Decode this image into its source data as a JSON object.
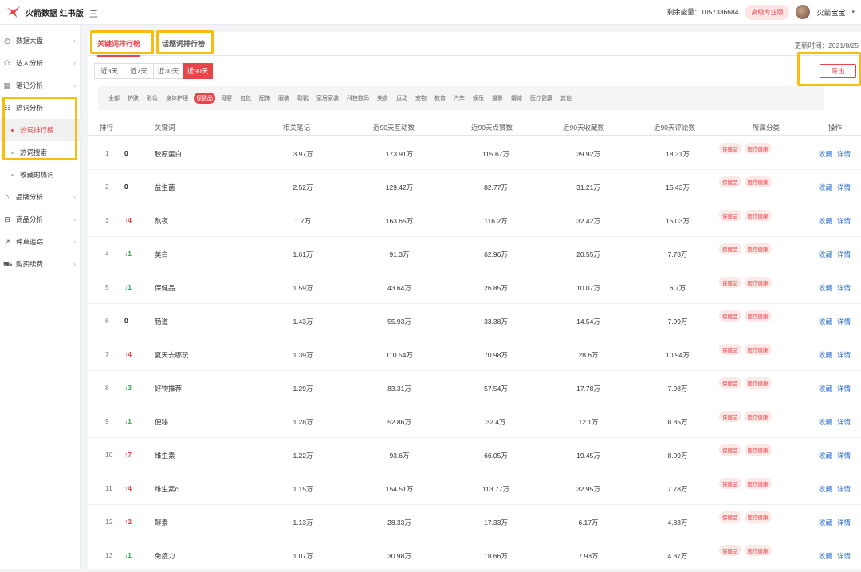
{
  "header": {
    "logo_text": "火箭数据 红书版",
    "menu_toggle": "三",
    "energy_label": "剩余能量：1057336684",
    "pro_badge": "高级专业版",
    "username": "火箭宝宝",
    "caret": "▾"
  },
  "sidebar": {
    "items": [
      {
        "icon": "dashboard-icon",
        "glyph": "◷",
        "label": "数据大盘",
        "arrow": "›"
      },
      {
        "icon": "user-group-icon",
        "glyph": "⚇",
        "label": "达人分析",
        "arrow": "›"
      },
      {
        "icon": "note-icon",
        "glyph": "▤",
        "label": "笔记分析",
        "arrow": "›"
      },
      {
        "icon": "hot-word-icon",
        "glyph": "☷",
        "label": "热词分析",
        "arrow": ""
      },
      {
        "icon": "brand-icon",
        "glyph": "⌂",
        "label": "品牌分析",
        "arrow": "›"
      },
      {
        "icon": "goods-icon",
        "glyph": "⊟",
        "label": "商品分析",
        "arrow": "›"
      },
      {
        "icon": "trend-icon",
        "glyph": "↗",
        "label": "种草追踪",
        "arrow": "›"
      },
      {
        "icon": "cart-icon",
        "glyph": "⛟",
        "label": "购买续费",
        "arrow": "›"
      }
    ],
    "sub_items": [
      {
        "label": "热词排行榜"
      },
      {
        "label": "热词搜索"
      },
      {
        "label": "收藏的热词"
      }
    ]
  },
  "tabs": {
    "keyword": "关键词排行榜",
    "topic": "话题词排行榜"
  },
  "update_time": "更新时间：2021/8/25",
  "ranges": [
    "近3天",
    "近7天",
    "近30天",
    "近90天"
  ],
  "export_label": "导出",
  "categories": [
    "全部",
    "护肤",
    "彩妆",
    "身体护理",
    "保健品",
    "母婴",
    "包包",
    "配饰",
    "服装",
    "鞋靴",
    "家居家装",
    "科技数码",
    "美食",
    "运动",
    "宠物",
    "教育",
    "汽车",
    "娱乐",
    "摄影",
    "婚嫁",
    "医疗健康",
    "其他"
  ],
  "table": {
    "headers": {
      "rank": "排行",
      "keyword": "关键词",
      "notes": "相关笔记",
      "interact": "近90天互动数",
      "likes": "近90天点赞数",
      "collect": "近90天收藏数",
      "comment": "近90天评论数",
      "category": "所属分类",
      "ops": "操作"
    },
    "tag1": "保健品",
    "tag2": "医疗健康",
    "op_collect": "收藏",
    "op_detail": "详情",
    "rows": [
      {
        "rank": "1",
        "change": "0",
        "dir": "same",
        "keyword": "胶原蛋白",
        "notes": "3.97万",
        "interact": "173.91万",
        "likes": "115.67万",
        "collect": "39.92万",
        "comment": "18.31万"
      },
      {
        "rank": "2",
        "change": "0",
        "dir": "same",
        "keyword": "益生菌",
        "notes": "2.52万",
        "interact": "129.42万",
        "likes": "82.77万",
        "collect": "31.21万",
        "comment": "15.43万"
      },
      {
        "rank": "3",
        "change": "↑4",
        "dir": "up",
        "keyword": "熬夜",
        "notes": "1.7万",
        "interact": "163.65万",
        "likes": "116.2万",
        "collect": "32.42万",
        "comment": "15.03万"
      },
      {
        "rank": "4",
        "change": "↓1",
        "dir": "down",
        "keyword": "美白",
        "notes": "1.61万",
        "interact": "91.3万",
        "likes": "62.96万",
        "collect": "20.55万",
        "comment": "7.78万"
      },
      {
        "rank": "5",
        "change": "↓1",
        "dir": "down",
        "keyword": "保健品",
        "notes": "1.59万",
        "interact": "43.64万",
        "likes": "26.85万",
        "collect": "10.07万",
        "comment": "6.7万"
      },
      {
        "rank": "6",
        "change": "0",
        "dir": "same",
        "keyword": "肠道",
        "notes": "1.43万",
        "interact": "55.93万",
        "likes": "33.38万",
        "collect": "14.54万",
        "comment": "7.99万"
      },
      {
        "rank": "7",
        "change": "↑4",
        "dir": "up",
        "keyword": "夏天去哪玩",
        "notes": "1.39万",
        "interact": "110.54万",
        "likes": "70.98万",
        "collect": "28.6万",
        "comment": "10.94万"
      },
      {
        "rank": "8",
        "change": "↓3",
        "dir": "down",
        "keyword": "好物推荐",
        "notes": "1.29万",
        "interact": "83.31万",
        "likes": "57.54万",
        "collect": "17.78万",
        "comment": "7.98万"
      },
      {
        "rank": "9",
        "change": "↓1",
        "dir": "down",
        "keyword": "便秘",
        "notes": "1.28万",
        "interact": "52.86万",
        "likes": "32.4万",
        "collect": "12.1万",
        "comment": "8.35万"
      },
      {
        "rank": "10",
        "change": "↑7",
        "dir": "up",
        "keyword": "维生素",
        "notes": "1.22万",
        "interact": "93.6万",
        "likes": "66.05万",
        "collect": "19.45万",
        "comment": "8.09万"
      },
      {
        "rank": "11",
        "change": "↑4",
        "dir": "up",
        "keyword": "维生素c",
        "notes": "1.15万",
        "interact": "154.51万",
        "likes": "113.77万",
        "collect": "32.95万",
        "comment": "7.78万"
      },
      {
        "rank": "12",
        "change": "↑2",
        "dir": "up",
        "keyword": "酵素",
        "notes": "1.13万",
        "interact": "28.33万",
        "likes": "17.33万",
        "collect": "6.17万",
        "comment": "4.83万"
      },
      {
        "rank": "13",
        "change": "↓1",
        "dir": "down",
        "keyword": "免疫力",
        "notes": "1.07万",
        "interact": "30.98万",
        "likes": "18.66万",
        "collect": "7.93万",
        "comment": "4.37万"
      }
    ]
  },
  "colors": {
    "accent": "#e8454a",
    "highlight": "#f7bd13",
    "link": "#2d6fd4",
    "down": "#2aa84a"
  }
}
